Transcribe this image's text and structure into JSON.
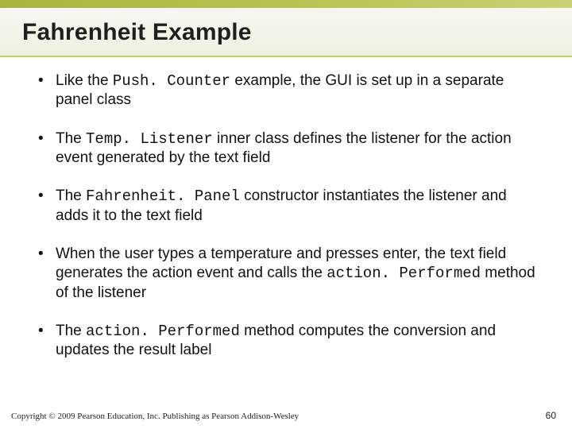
{
  "title": "Fahrenheit Example",
  "bullets": {
    "b1a": "Like the ",
    "b1code": "Push. Counter",
    "b1b": " example, the GUI is set up in a separate panel class",
    "b2a": "The ",
    "b2code": "Temp. Listener",
    "b2b": " inner class defines the listener for the action event generated by the text field",
    "b3a": "The ",
    "b3code": "Fahrenheit. Panel",
    "b3b": " constructor instantiates the listener and adds it to the text field",
    "b4a": "When the user types a temperature and presses enter, the text field generates the action event and calls the ",
    "b4code": "action. Performed",
    "b4b": " method of the listener",
    "b5a": "The ",
    "b5code": "action. Performed",
    "b5b": " method computes the conversion and updates the result label"
  },
  "footer": {
    "copyright": "Copyright © 2009 Pearson Education, Inc. Publishing as Pearson Addison-Wesley",
    "page": "60"
  }
}
